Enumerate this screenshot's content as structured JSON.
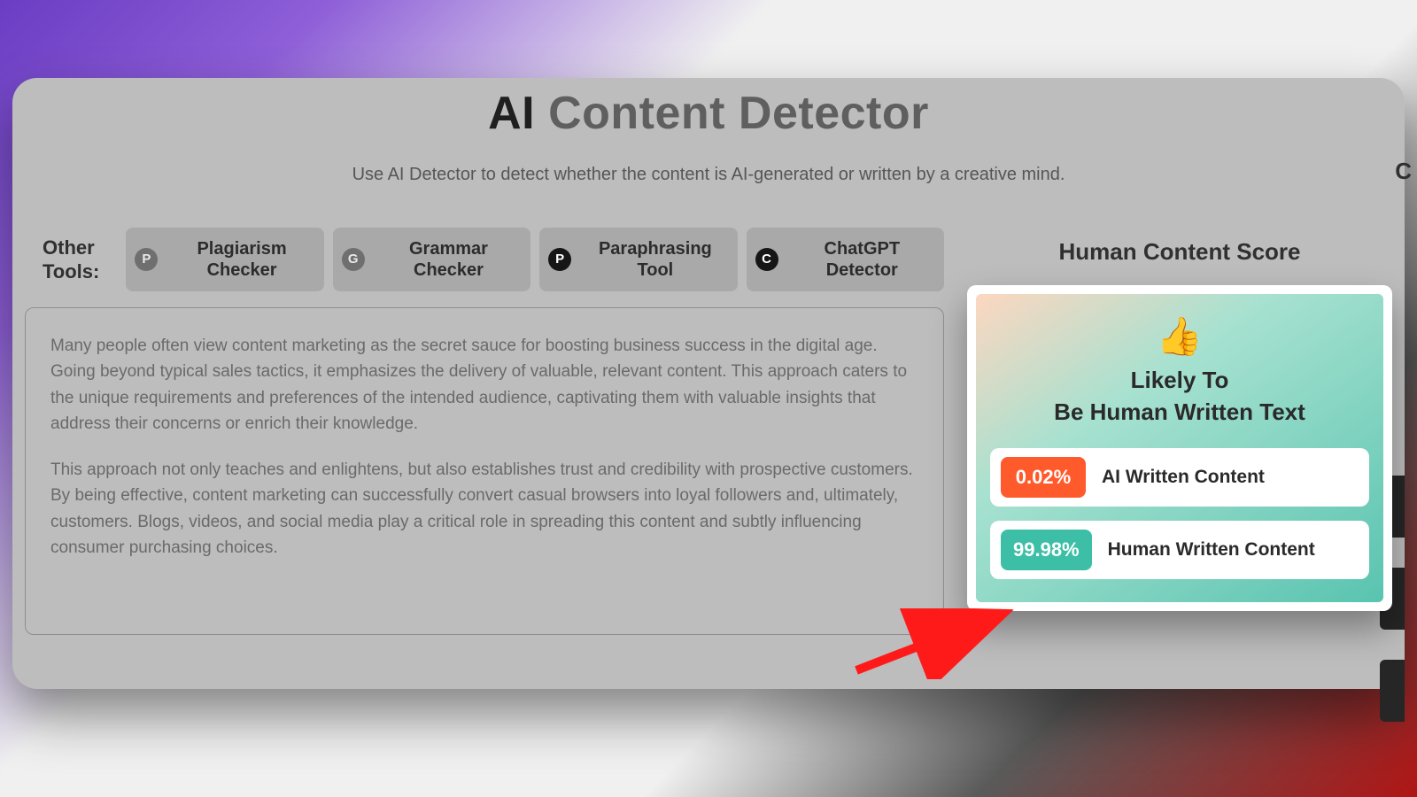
{
  "header": {
    "title_bold": "AI",
    "title_rest": " Content Detector",
    "subtitle": "Use AI Detector to detect whether the content is AI-generated or written by a creative mind."
  },
  "tools": {
    "label": "Other Tools:",
    "items": [
      {
        "badge": "P",
        "label": "Plagiarism Checker"
      },
      {
        "badge": "G",
        "label": "Grammar Checker"
      },
      {
        "badge": "P",
        "label": "Paraphrasing Tool"
      },
      {
        "badge": "C",
        "label": "ChatGPT Detector"
      }
    ]
  },
  "input": {
    "para1": "Many people often view content marketing as the secret sauce for boosting business success in the digital age. Going beyond typical sales tactics, it emphasizes the delivery of valuable, relevant content. This approach caters to the unique requirements and preferences of the intended audience, captivating them with valuable insights that address their concerns or enrich their knowledge.",
    "para2": "This approach not only teaches and enlightens, but also establishes trust and credibility with prospective customers. By being effective, content marketing can successfully convert casual browsers into loyal followers and, ultimately, customers. Blogs, videos, and social media play a critical role in spreading this content and subtly influencing consumer purchasing choices."
  },
  "score": {
    "heading": "Human Content Score",
    "thumb": "👍",
    "verdict_line1": "Likely To",
    "verdict_line2": "Be Human Written Text",
    "ai_pct": "0.02%",
    "ai_label": "AI Written Content",
    "human_pct": "99.98%",
    "human_label": "Human Written Content"
  }
}
